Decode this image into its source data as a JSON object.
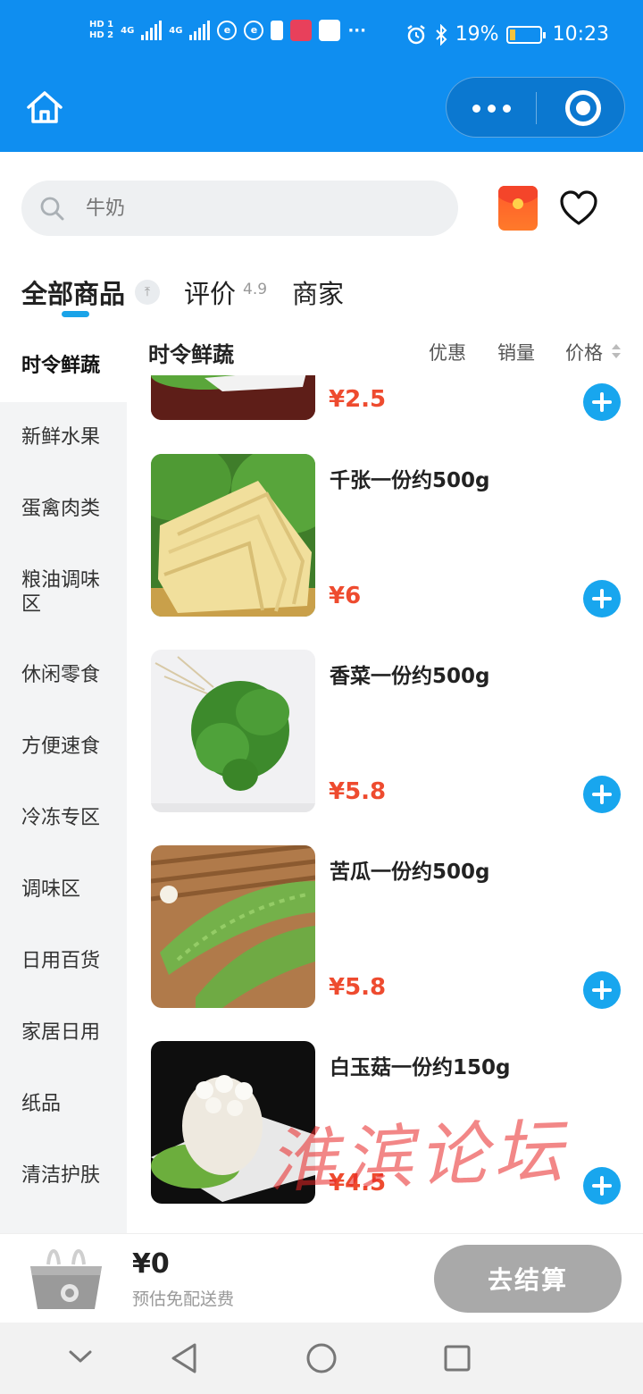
{
  "status_bar": {
    "hd1": "HD 1",
    "hd2": "HD 2",
    "network1": "4G",
    "network2": "4G",
    "battery_text": "19%",
    "battery_level": 0.19,
    "time": "10:23",
    "more": "···"
  },
  "header": {
    "home_icon": "home-icon",
    "more_icon": "more-dots-icon",
    "close_icon": "target-close-icon"
  },
  "search": {
    "placeholder": "牛奶",
    "icons": [
      "search-icon",
      "red-packet-icon",
      "heart-icon"
    ]
  },
  "tabs": {
    "all": "全部商品",
    "review": "评价",
    "rating": "4.9",
    "merchant": "商家",
    "pin_glyph": "⤒"
  },
  "sidebar": {
    "items": [
      {
        "label": "时令鲜蔬",
        "active": true
      },
      {
        "label": "新鲜水果"
      },
      {
        "label": "蛋禽肉类"
      },
      {
        "label": "粮油调味区"
      },
      {
        "label": "休闲零食"
      },
      {
        "label": "方便速食"
      },
      {
        "label": "冷冻专区"
      },
      {
        "label": "调味区"
      },
      {
        "label": "日用百货"
      },
      {
        "label": "家居日用"
      },
      {
        "label": "纸品"
      },
      {
        "label": "清洁护肤"
      }
    ]
  },
  "list": {
    "title": "时令鲜蔬",
    "sort_discount": "优惠",
    "sort_sales": "销量",
    "sort_price": "价格"
  },
  "products": [
    {
      "name": "",
      "price": "¥2.5"
    },
    {
      "name": "千张一份约500g",
      "price": "¥6"
    },
    {
      "name": "香菜一份约500g",
      "price": "¥5.8"
    },
    {
      "name": "苦瓜一份约500g",
      "price": "¥5.8"
    },
    {
      "name": "白玉菇一份约150g",
      "price": "¥4.5"
    }
  ],
  "watermark": "淮滨论坛",
  "cart": {
    "total": "¥0",
    "note": "预估免配送费",
    "checkout": "去结算"
  },
  "colors": {
    "brand_blue": "#0f8ef0",
    "accent_cyan": "#18a6ee",
    "price_red": "#ee4b2f",
    "checkout_gray": "#a9a9a9"
  }
}
